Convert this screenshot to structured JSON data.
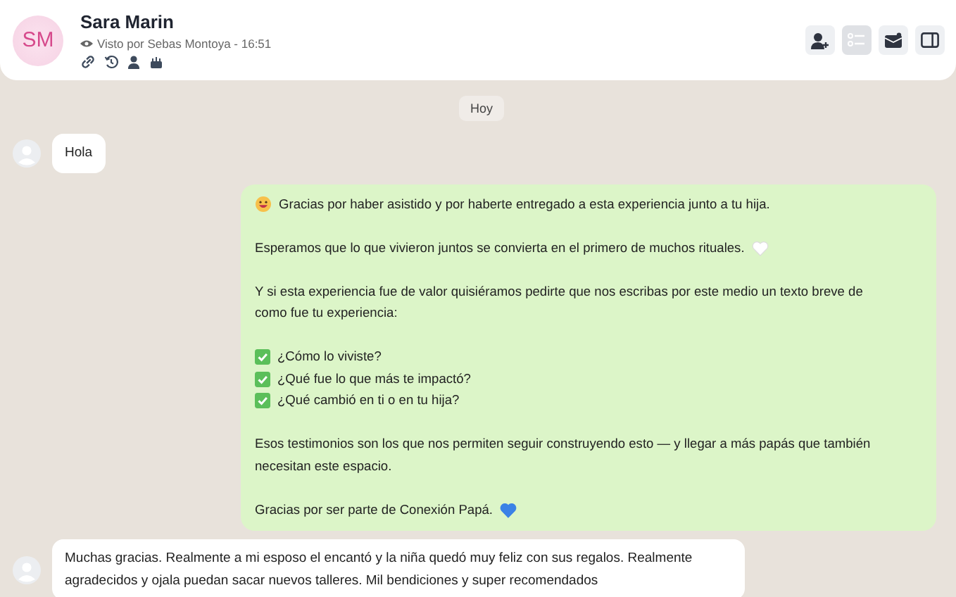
{
  "contact": {
    "initials": "SM",
    "name": "Sara Marin",
    "seen": "Visto por Sebas Montoya - 16:51"
  },
  "day_label": "Hoy",
  "messages": [
    {
      "kind": "incoming",
      "blocks": [
        {
          "kind": "plain",
          "text": "Hola"
        }
      ]
    },
    {
      "kind": "outgoing",
      "blocks": [
        {
          "kind": "greeting",
          "text": "Gracias por haber asistido y por haberte entregado a esta experiencia junto a tu hija."
        },
        {
          "kind": "wish",
          "text": "Esperamos que lo que vivieron juntos se convierta en el primero de muchos rituales."
        },
        {
          "kind": "plain",
          "text": "Y si esta experiencia fue de valor quisiéramos pedirte que nos escribas por este medio un texto breve de como fue tu experiencia:"
        },
        {
          "kind": "checklist",
          "items": [
            "¿Cómo lo viviste?",
            "¿Qué fue lo que más te impactó?",
            "¿Qué cambió en ti o en tu hija?"
          ]
        },
        {
          "kind": "plain",
          "text": "Esos testimonios son los que nos permiten seguir construyendo esto — y llegar a más papás que también necesitan este espacio."
        },
        {
          "kind": "thanks",
          "text": "Gracias por ser parte de Conexión Papá."
        }
      ]
    },
    {
      "kind": "incoming",
      "blocks": [
        {
          "kind": "plain",
          "text": "Muchas gracias. Realmente a mi esposo el encantó y la niña quedó muy feliz con sus regalos. Realmente agradecidos y ojala puedan sacar nuevos talleres. Mil bendiciones y super recomendados"
        }
      ]
    }
  ]
}
